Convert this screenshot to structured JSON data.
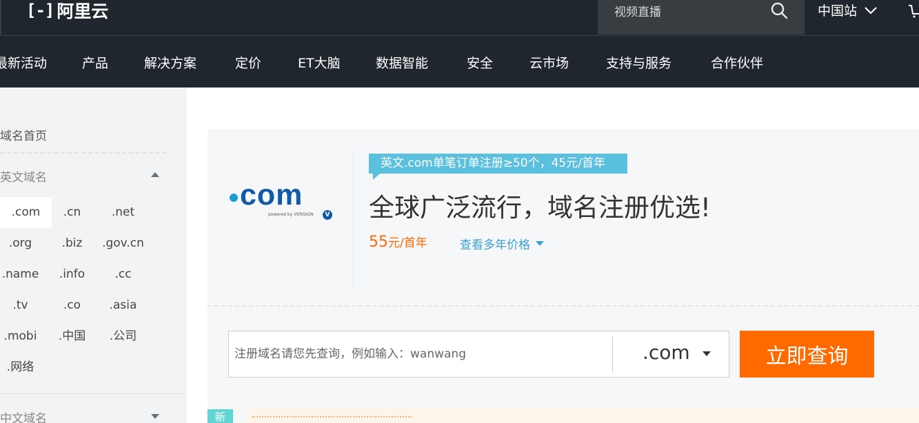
{
  "header": {
    "logo_mark": "[-]",
    "logo_text": "阿里云",
    "search_placeholder": "视频直播",
    "site_switch": "中国站"
  },
  "nav": {
    "items": [
      "最新活动",
      "产品",
      "解决方案",
      "定价",
      "ET大脑",
      "数据智能",
      "安全",
      "云市场",
      "支持与服务",
      "合作伙伴"
    ]
  },
  "sidebar": {
    "home": "域名首页",
    "english_section": "英文域名",
    "english_tlds": [
      ".com",
      ".cn",
      ".net",
      ".org",
      ".biz",
      ".gov.cn",
      ".name",
      ".info",
      ".cc",
      ".tv",
      ".co",
      ".asia",
      ".mobi",
      ".中国",
      ".公司",
      ".网络"
    ],
    "active_tld": ".com",
    "chinese_section": "中文域名"
  },
  "product": {
    "logo_word": "com",
    "logo_powered": "powered by VERISIGN",
    "logo_badge": "V",
    "promo": "英文.com单笔订单注册≥50个，45元/首年",
    "headline": "全球广泛流行，域名注册优选!",
    "price_value": "55",
    "price_unit": "元/首年",
    "multi_year_link": "查看多年价格"
  },
  "query": {
    "placeholder": "注册域名请您先查询，例如输入：wanwang",
    "value": "",
    "selected_tld": ".com",
    "button": "立即查询"
  },
  "bottom": {
    "new_badge": "新"
  },
  "colors": {
    "header_bg": "#1f262d",
    "accent_orange": "#ff6a00",
    "promo_blue": "#5bc0de",
    "link_blue": "#3d9fd6",
    "logo_blue": "#125aa6"
  }
}
